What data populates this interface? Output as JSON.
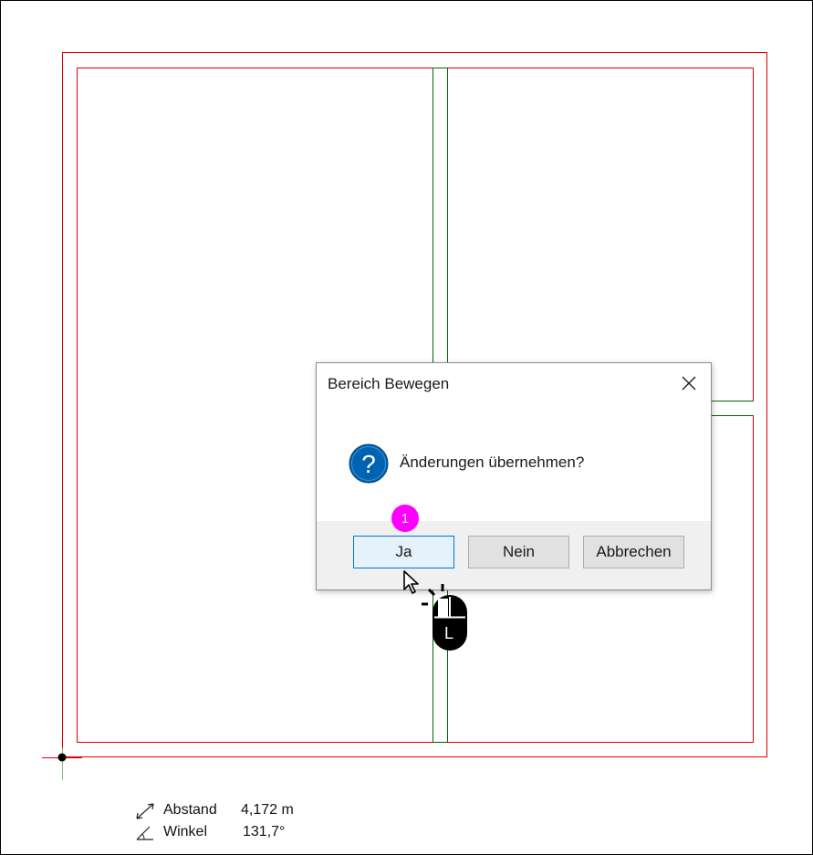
{
  "dialog": {
    "title": "Bereich Bewegen",
    "message": "Änderungen übernehmen?",
    "buttons": {
      "yes": "Ja",
      "no": "Nein",
      "cancel": "Abbrechen"
    }
  },
  "annotation": {
    "step": "1",
    "mouse_button": "L"
  },
  "status": {
    "distance_label": "Abstand",
    "distance_value": "4,172 m",
    "angle_label": "Winkel",
    "angle_value": "131,7°"
  },
  "colors": {
    "wall_outline": "#e00000",
    "wall_centerline": "#006600",
    "step_badge": "#ff00ff",
    "question_icon": "#0063b1",
    "default_button_border": "#0078d7"
  }
}
